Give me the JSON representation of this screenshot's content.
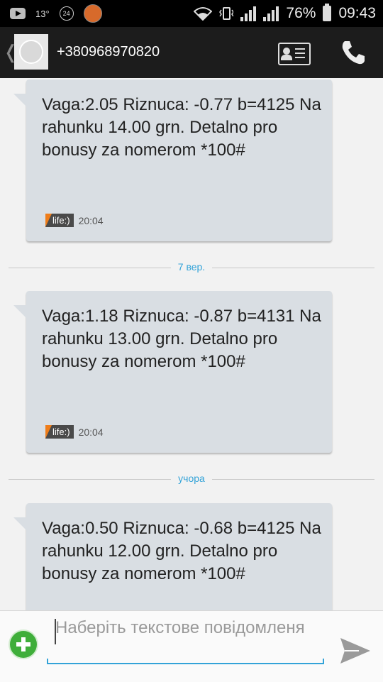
{
  "status_bar": {
    "temperature": "13°",
    "channel_badge": "24",
    "battery_percent": "76%",
    "time": "09:43",
    "icons": [
      "youtube-icon",
      "channel-24-icon",
      "app-notification-icon",
      "wifi-icon",
      "vibrate-icon",
      "signal-icon",
      "battery-icon"
    ]
  },
  "header": {
    "contact": "+380968970820",
    "icons": [
      "back-icon",
      "contact-avatar-icon",
      "contact-card-icon",
      "phone-icon"
    ]
  },
  "messages": [
    {
      "text": "Vaga:2.05 Riznuca: -0.77 b=4125 Na rahunku 14.00 grn. Detalno pro bonusy za nomerom *100#",
      "operator": "life:)",
      "time": "20:04"
    },
    {
      "text": "Vaga:1.18 Riznuca: -0.87 b=4131 Na rahunku 13.00 grn. Detalno pro bonusy za nomerom *100#",
      "operator": "life:)",
      "time": "20:04"
    },
    {
      "text": "Vaga:0.50 Riznuca: -0.68 b=4125 Na rahunku 12.00 grn. Detalno pro bonusy za nomerom *100#",
      "operator": "",
      "time": ""
    }
  ],
  "date_dividers": [
    "7 вер.",
    "учора"
  ],
  "compose": {
    "placeholder": "Наберіть текстове повідомленя",
    "icons": [
      "attach-plus-icon",
      "send-icon"
    ]
  },
  "colors": {
    "accent": "#33a3d8",
    "bubble": "#d9dee3",
    "action_bar": "#1c1c1c",
    "attach_green": "#3fae3a"
  }
}
